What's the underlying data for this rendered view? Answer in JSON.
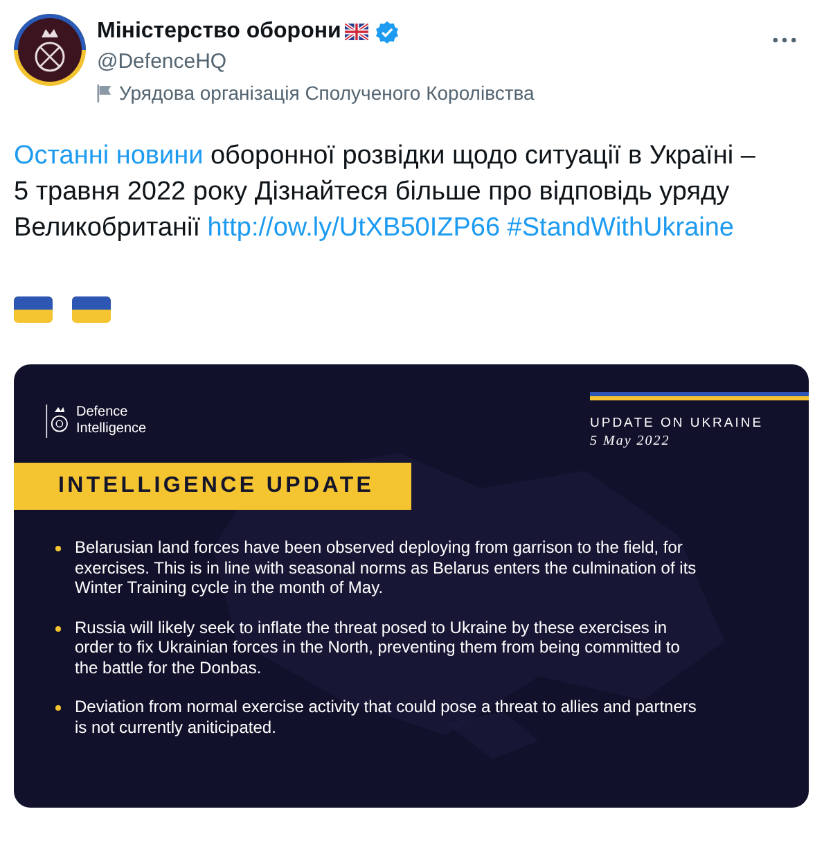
{
  "account": {
    "name": "Міністерство оборони",
    "verified": true,
    "handle": "@DefenceHQ",
    "label": "Урядова організація Сполученого Королівства"
  },
  "tweet": {
    "segments": [
      {
        "kind": "link",
        "text": "Останні новини"
      },
      {
        "kind": "text",
        "text": " оборонної розвідки щодо ситуації в Україні – 5 травня 2022 року Дізнайтеся більше про відповідь уряду Великобританії "
      },
      {
        "kind": "link",
        "text": "http://ow.ly/UtXB50IZP66"
      },
      {
        "kind": "link",
        "text": "#StandWithUkraine"
      }
    ]
  },
  "image": {
    "org": "Defence Intelligence",
    "kicker": "UPDATE ON UKRAINE",
    "date": "5 May 2022",
    "banner": "INTELLIGENCE UPDATE",
    "bullets": [
      "Belarusian land forces have been observed deploying from garrison to the field, for exercises. This is in line with seasonal norms as Belarus enters the culmination of its Winter Training cycle in the month of May.",
      "Russia will likely seek to inflate the threat posed to Ukraine by these exercises in order to fix Ukrainian forces in the North, preventing them from being committed to the battle for the Donbas.",
      "Deviation from normal exercise activity that could pose a threat to allies and partners is not currently aniticipated."
    ]
  }
}
